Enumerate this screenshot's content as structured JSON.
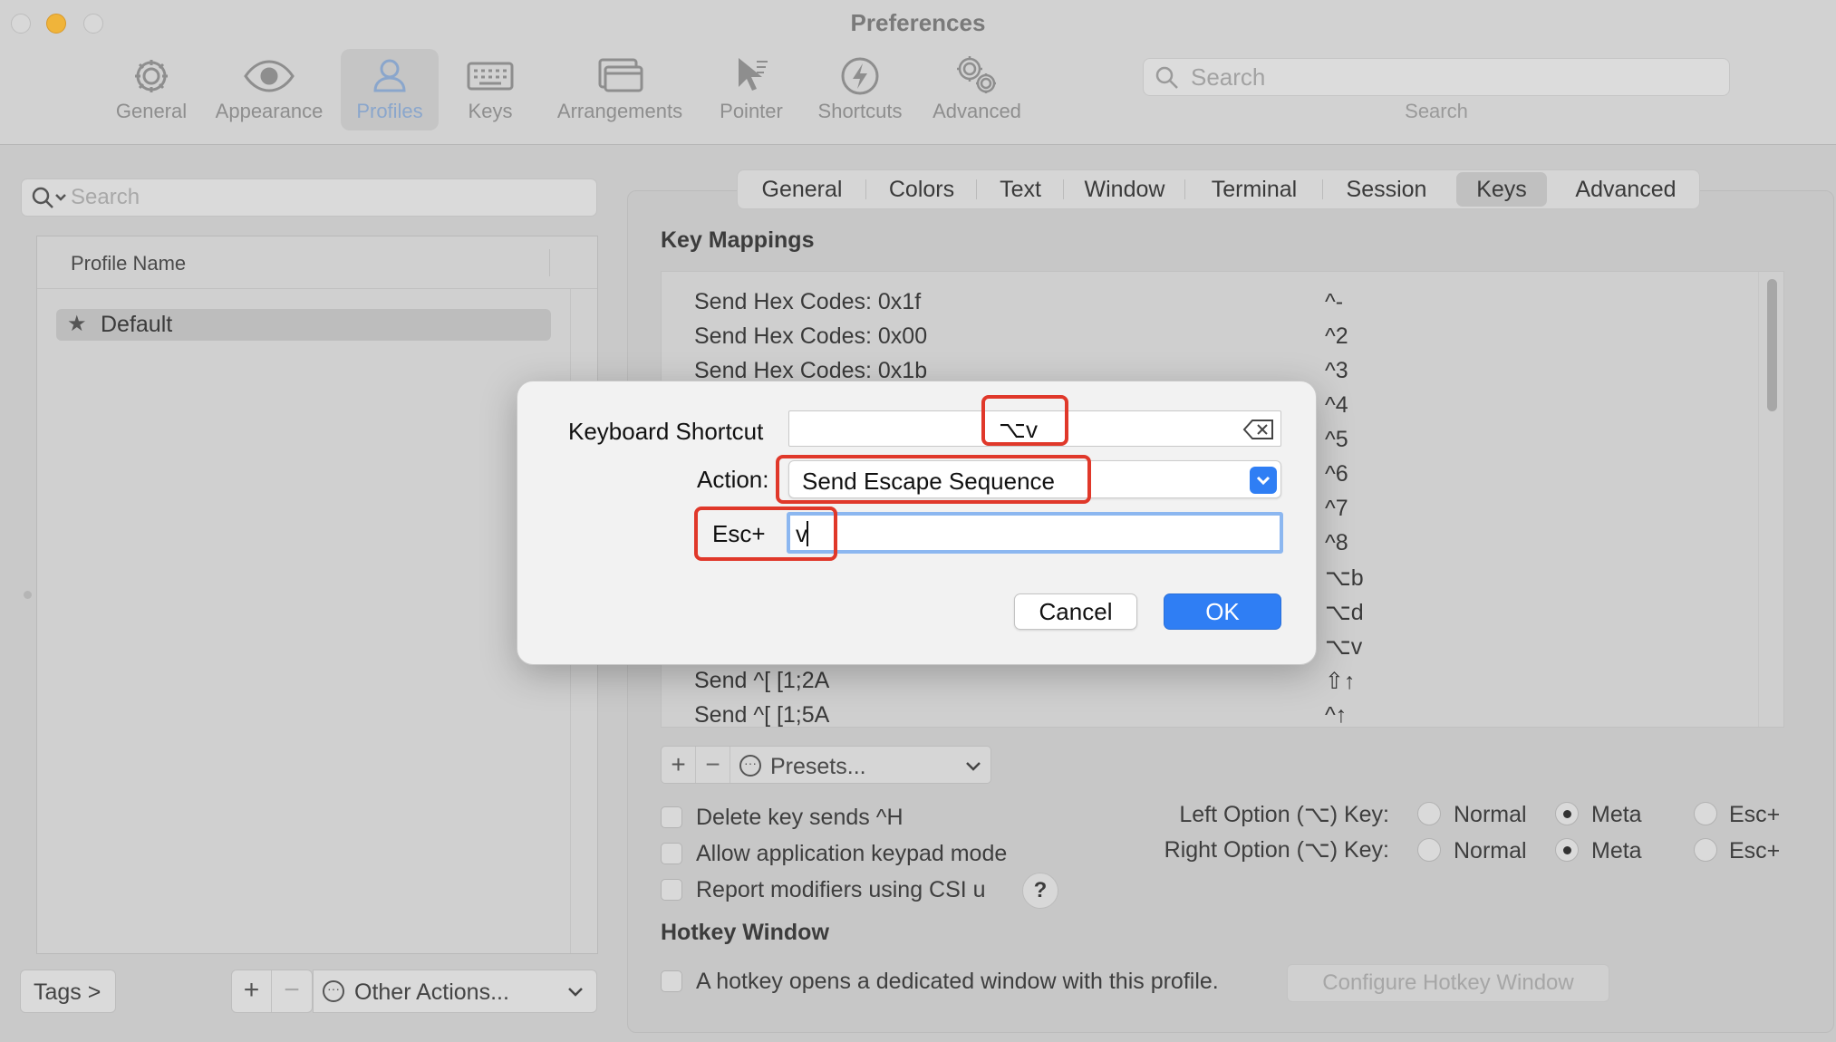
{
  "window": {
    "title": "Preferences"
  },
  "toolbar": {
    "items": [
      {
        "label": "General",
        "icon": "gear-icon"
      },
      {
        "label": "Appearance",
        "icon": "eye-icon"
      },
      {
        "label": "Profiles",
        "icon": "person-icon"
      },
      {
        "label": "Keys",
        "icon": "keyboard-icon"
      },
      {
        "label": "Arrangements",
        "icon": "window-arrangement-icon"
      },
      {
        "label": "Pointer",
        "icon": "pointer-icon"
      },
      {
        "label": "Shortcuts",
        "icon": "lightning-icon"
      },
      {
        "label": "Advanced",
        "icon": "gears-icon"
      }
    ],
    "active": "Profiles",
    "search_placeholder": "Search",
    "search_label": "Search"
  },
  "profiles": {
    "search_placeholder": "Search",
    "column_header": "Profile Name",
    "rows": [
      {
        "name": "Default",
        "default": true
      }
    ],
    "tags_label": "Tags >",
    "add_label": "+",
    "remove_label": "−",
    "other_actions_label": "Other Actions..."
  },
  "profile_tabs": {
    "tabs": [
      "General",
      "Colors",
      "Text",
      "Window",
      "Terminal",
      "Session",
      "Keys",
      "Advanced"
    ],
    "active": "Keys"
  },
  "keys": {
    "key_mappings_heading": "Key Mappings",
    "mappings": [
      {
        "action": "Send Hex Codes: 0x1f",
        "key": "^-"
      },
      {
        "action": "Send Hex Codes: 0x00",
        "key": "^2"
      },
      {
        "action": "Send Hex Codes: 0x1b",
        "key": "^3"
      },
      {
        "action": "",
        "key": "^4"
      },
      {
        "action": "",
        "key": "^5"
      },
      {
        "action": "",
        "key": "^6"
      },
      {
        "action": "",
        "key": "^7"
      },
      {
        "action": "",
        "key": "^8"
      },
      {
        "action": "",
        "key": "⌥b"
      },
      {
        "action": "",
        "key": "⌥d"
      },
      {
        "action": "",
        "key": "⌥v"
      },
      {
        "action": "Send ^[ [1;2A",
        "key": "⇧↑"
      },
      {
        "action": "Send ^[ [1;5A",
        "key": "^↑"
      }
    ],
    "add_label": "+",
    "remove_label": "−",
    "presets_label": "Presets...",
    "checkboxes": [
      {
        "label": "Delete key sends ^H",
        "checked": false
      },
      {
        "label": "Allow application keypad mode",
        "checked": false
      },
      {
        "label": "Report modifiers using CSI u",
        "checked": false
      }
    ],
    "help_label": "?",
    "left_option_label": "Left Option (⌥) Key:",
    "right_option_label": "Right Option (⌥) Key:",
    "option_choices": [
      "Normal",
      "Meta",
      "Esc+"
    ],
    "left_option_selected": "Meta",
    "right_option_selected": "Meta",
    "hotkey_heading": "Hotkey Window",
    "hotkey_checkbox_label": "A hotkey opens a dedicated window with this profile.",
    "hotkey_button_label": "Configure Hotkey Window"
  },
  "dialog": {
    "shortcut_label": "Keyboard Shortcut",
    "shortcut_value": "⌥v",
    "action_label": "Action:",
    "action_value": "Send Escape Sequence",
    "esc_label": "Esc+",
    "esc_value": "v",
    "cancel_label": "Cancel",
    "ok_label": "OK"
  },
  "colors": {
    "accent": "#2f7ef4",
    "highlight": "#e0382a"
  }
}
